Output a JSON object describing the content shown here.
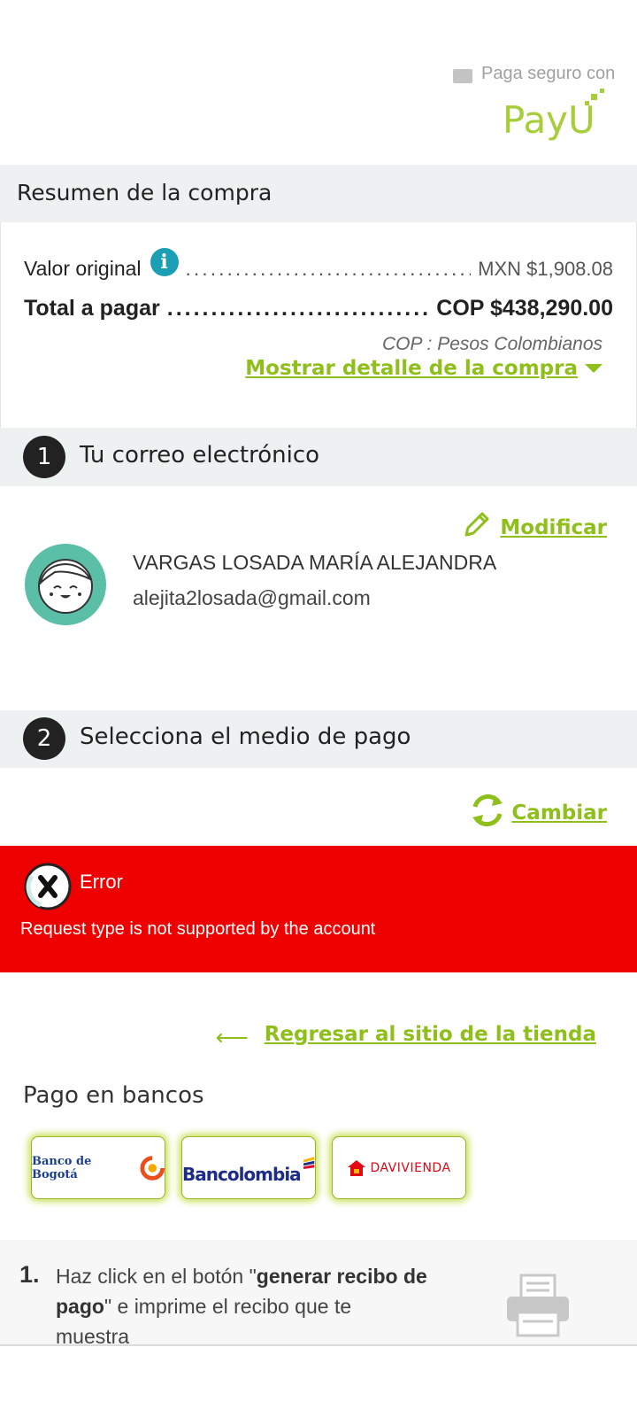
{
  "header": {
    "secure_pay_text": "Paga seguro con",
    "brand": "PayU"
  },
  "summary": {
    "title": "Resumen de la compra",
    "original_label": "Valor original",
    "original_value": "MXN $1,908.08",
    "total_label": "Total a pagar",
    "total_value": "COP $438,290.00",
    "currency_note": "COP : Pesos Colombianos",
    "details_link": "Mostrar detalle de la compra"
  },
  "step1": {
    "number": "1",
    "title": "Tu correo electrónico",
    "modify_link": "Modificar",
    "user_name": "VARGAS LOSADA MARÍA ALEJANDRA",
    "user_email": "alejita2losada@gmail.com"
  },
  "step2": {
    "number": "2",
    "title": "Selecciona el medio de pago",
    "change_link": "Cambiar"
  },
  "error": {
    "title": "Error",
    "message": "Request type is not supported by the account"
  },
  "back_link": "Regresar al sitio de la tienda",
  "banks": {
    "title": "Pago en bancos",
    "items": [
      "Banco de Bogotá",
      "Bancolombia",
      "DAVIVIENDA"
    ]
  },
  "instructions": {
    "step_number": "1.",
    "text_before": "Haz click en el botón \"",
    "text_bold": "generar recibo de pago",
    "text_after": "\" e imprime el recibo que te muestra"
  },
  "colors": {
    "brand_green": "#8fbf1b",
    "error_red": "#ee0000",
    "info_blue": "#1a9fb5",
    "section_gray": "#edf1f2",
    "avatar_teal": "#5bbfa8"
  },
  "icons": [
    "lock-icon",
    "info-icon",
    "pencil-icon",
    "avatar-icon",
    "refresh-icon",
    "error-x-icon",
    "back-arrow-icon",
    "printer-icon"
  ]
}
